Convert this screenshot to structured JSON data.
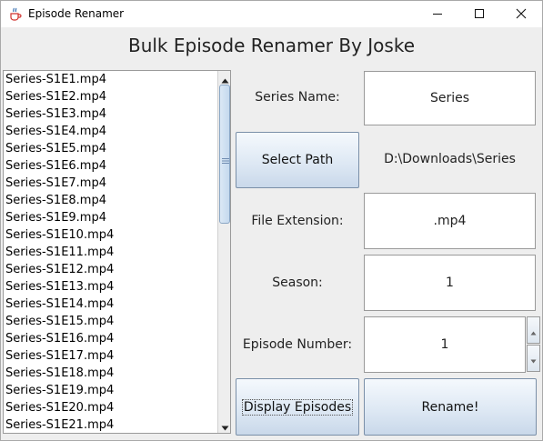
{
  "window": {
    "title": "Episode Renamer",
    "heading": "Bulk Episode Renamer By Joske"
  },
  "episodes": [
    "Series-S1E1.mp4",
    "Series-S1E2.mp4",
    "Series-S1E3.mp4",
    "Series-S1E4.mp4",
    "Series-S1E5.mp4",
    "Series-S1E6.mp4",
    "Series-S1E7.mp4",
    "Series-S1E8.mp4",
    "Series-S1E9.mp4",
    "Series-S1E10.mp4",
    "Series-S1E11.mp4",
    "Series-S1E12.mp4",
    "Series-S1E13.mp4",
    "Series-S1E14.mp4",
    "Series-S1E15.mp4",
    "Series-S1E16.mp4",
    "Series-S1E17.mp4",
    "Series-S1E18.mp4",
    "Series-S1E19.mp4",
    "Series-S1E20.mp4",
    "Series-S1E21.mp4"
  ],
  "form": {
    "series_name_label": "Series Name:",
    "series_name_value": "Series",
    "select_path_button": "Select Path",
    "path_value": "D:\\Downloads\\Series",
    "file_extension_label": "File Extension:",
    "file_extension_value": ".mp4",
    "season_label": "Season:",
    "season_value": "1",
    "episode_number_label": "Episode Number:",
    "episode_number_value": "1",
    "display_episodes_button": "Display Episodes",
    "rename_button": "Rename!"
  },
  "icons": {
    "app": "java-cup-icon",
    "minimize": "minimize-icon",
    "maximize": "maximize-icon",
    "close": "close-icon"
  }
}
